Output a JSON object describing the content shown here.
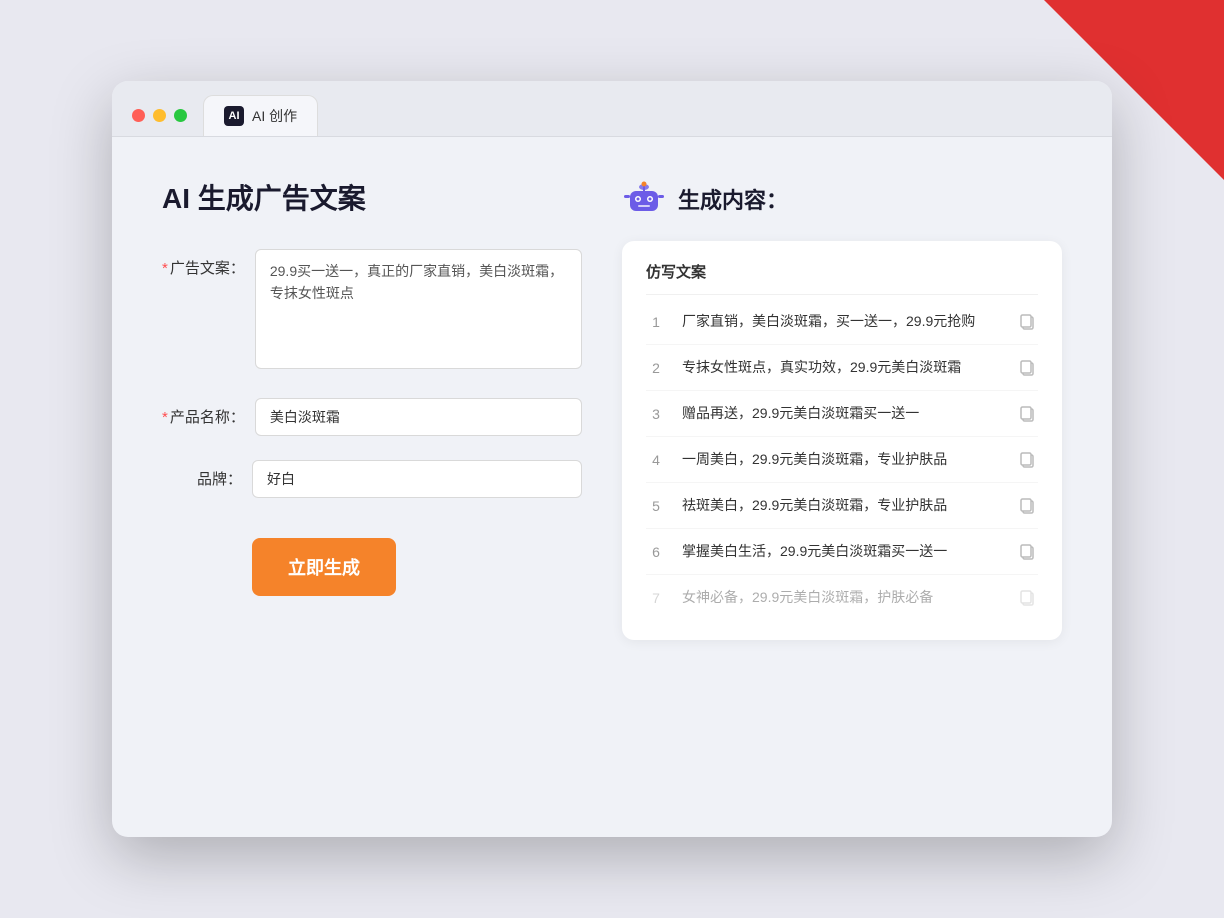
{
  "window": {
    "tab_label": "AI 创作",
    "tab_icon_text": "AI"
  },
  "left_panel": {
    "title": "AI 生成广告文案",
    "fields": [
      {
        "label": "广告文案：",
        "required": true,
        "type": "textarea",
        "value": "29.9买一送一，真正的厂家直销，美白淡斑霜，专抹女性斑点",
        "placeholder": ""
      },
      {
        "label": "产品名称：",
        "required": true,
        "type": "input",
        "value": "美白淡斑霜",
        "placeholder": ""
      },
      {
        "label": "品牌：",
        "required": false,
        "type": "input",
        "value": "好白",
        "placeholder": ""
      }
    ],
    "button_label": "立即生成"
  },
  "right_panel": {
    "title": "生成内容：",
    "table_header": "仿写文案",
    "items": [
      {
        "num": "1",
        "text": "厂家直销，美白淡斑霜，买一送一，29.9元抢购",
        "dimmed": false
      },
      {
        "num": "2",
        "text": "专抹女性斑点，真实功效，29.9元美白淡斑霜",
        "dimmed": false
      },
      {
        "num": "3",
        "text": "赠品再送，29.9元美白淡斑霜买一送一",
        "dimmed": false
      },
      {
        "num": "4",
        "text": "一周美白，29.9元美白淡斑霜，专业护肤品",
        "dimmed": false
      },
      {
        "num": "5",
        "text": "祛斑美白，29.9元美白淡斑霜，专业护肤品",
        "dimmed": false
      },
      {
        "num": "6",
        "text": "掌握美白生活，29.9元美白淡斑霜买一送一",
        "dimmed": false
      },
      {
        "num": "7",
        "text": "女神必备，29.9元美白淡斑霜，护肤必备",
        "dimmed": true
      }
    ]
  }
}
